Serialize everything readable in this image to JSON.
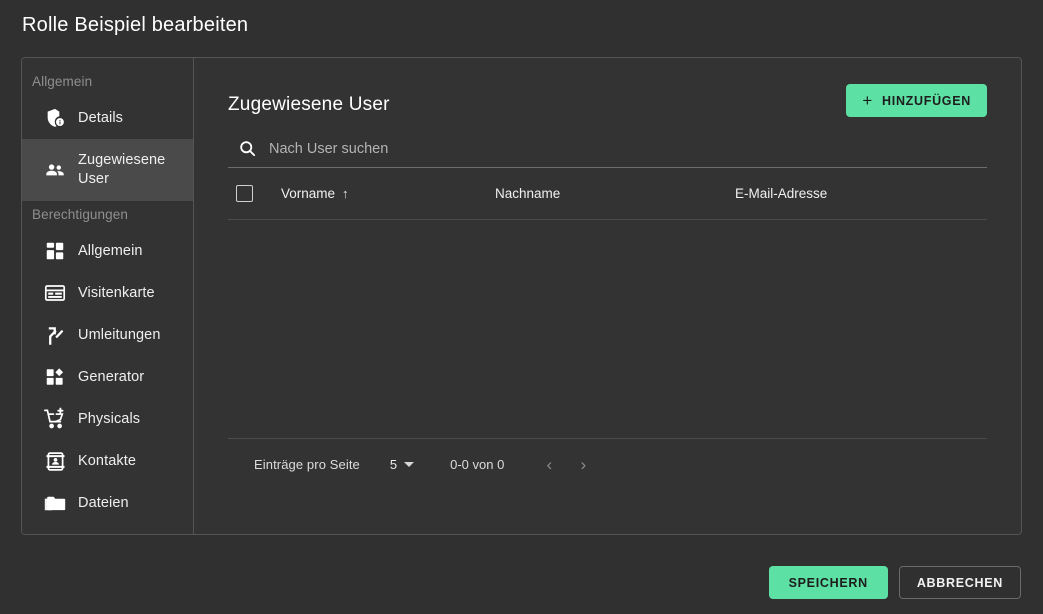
{
  "window": {
    "title": "Rolle Beispiel bearbeiten"
  },
  "sidebar": {
    "sections": [
      {
        "label": "Allgemein",
        "items": [
          {
            "label": "Details",
            "icon": "shield-info-icon",
            "selected": false
          },
          {
            "label": "Zugewiesene User",
            "icon": "users-icon",
            "selected": true
          }
        ]
      },
      {
        "label": "Berechtigungen",
        "items": [
          {
            "label": "Allgemein",
            "icon": "dashboard-grid-icon",
            "selected": false
          },
          {
            "label": "Visitenkarte",
            "icon": "business-card-icon",
            "selected": false
          },
          {
            "label": "Umleitungen",
            "icon": "redirect-fork-icon",
            "selected": false
          },
          {
            "label": "Generator",
            "icon": "generator-grid-icon",
            "selected": false
          },
          {
            "label": "Physicals",
            "icon": "cart-plus-icon",
            "selected": false
          },
          {
            "label": "Kontakte",
            "icon": "contact-card-icon",
            "selected": false
          },
          {
            "label": "Dateien",
            "icon": "folder-icon",
            "selected": false
          }
        ]
      }
    ]
  },
  "main": {
    "title": "Zugewiesene User",
    "add_button": {
      "label": "HINZUFÜGEN",
      "plus": "+"
    },
    "search": {
      "placeholder": "Nach User suchen",
      "value": "",
      "icon": "search-icon"
    },
    "table": {
      "columns": [
        {
          "label": "Vorname",
          "sorted": "asc",
          "sort_glyph": "↑"
        },
        {
          "label": "Nachname",
          "sorted": "none",
          "sort_glyph": ""
        },
        {
          "label": "E-Mail-Adresse",
          "sorted": "none",
          "sort_glyph": ""
        }
      ],
      "rows": []
    },
    "paginator": {
      "items_per_page_label": "Einträge pro Seite",
      "page_size": "5",
      "range_label": "0-0 von 0",
      "prev_glyph": "‹",
      "next_glyph": "›"
    }
  },
  "footer": {
    "save_label": "SPEICHERN",
    "cancel_label": "ABBRECHEN"
  },
  "colors": {
    "background": "#303030",
    "panel": "#333333",
    "border": "#545454",
    "accent_green": "#5ce0a4",
    "selected_item": "#4a4a4a",
    "muted_text": "#8f8f8f"
  }
}
